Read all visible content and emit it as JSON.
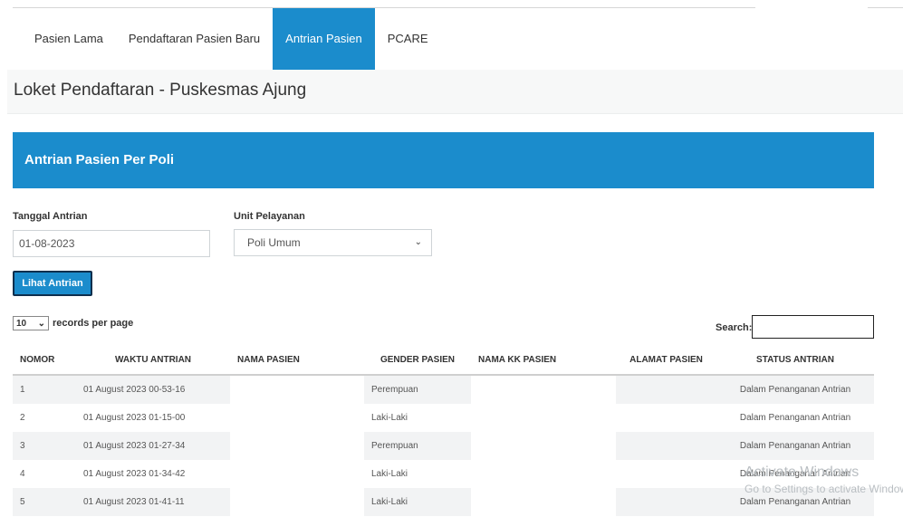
{
  "nav": {
    "items": [
      {
        "label": "Pasien Lama",
        "active": false
      },
      {
        "label": "Pendaftaran Pasien Baru",
        "active": false
      },
      {
        "label": "Antrian Pasien",
        "active": true
      },
      {
        "label": "PCARE",
        "active": false
      }
    ]
  },
  "page": {
    "title": "Loket Pendaftaran - Puskesmas Ajung"
  },
  "panel": {
    "title": "Antrian Pasien Per Poli"
  },
  "form": {
    "date_label": "Tanggal Antrian",
    "date_value": "01-08-2023",
    "unit_label": "Unit Pelayanan",
    "unit_value": "Poli Umum",
    "submit_label": "Lihat Antrian"
  },
  "table_controls": {
    "page_length": "10",
    "records_label": "records per page",
    "search_label": "Search:",
    "search_value": ""
  },
  "table": {
    "headers": [
      "NOMOR",
      "WAKTU ANTRIAN",
      "NAMA PASIEN",
      "GENDER PASIEN",
      "NAMA KK PASIEN",
      "ALAMAT PASIEN",
      "STATUS ANTRIAN"
    ],
    "rows": [
      {
        "nomor": "1",
        "waktu": "01 August 2023 00-53-16",
        "nama": "",
        "gender": "Perempuan",
        "kk": "",
        "alamat": "",
        "status": "Dalam Penanganan Antrian"
      },
      {
        "nomor": "2",
        "waktu": "01 August 2023 01-15-00",
        "nama": "",
        "gender": "Laki-Laki",
        "kk": "",
        "alamat": "",
        "status": "Dalam Penanganan Antrian"
      },
      {
        "nomor": "3",
        "waktu": "01 August 2023 01-27-34",
        "nama": "",
        "gender": "Perempuan",
        "kk": "",
        "alamat": "",
        "status": "Dalam Penanganan Antrian"
      },
      {
        "nomor": "4",
        "waktu": "01 August 2023 01-34-42",
        "nama": "",
        "gender": "Laki-Laki",
        "kk": "",
        "alamat": "",
        "status": "Dalam Penanganan Antrian"
      },
      {
        "nomor": "5",
        "waktu": "01 August 2023 01-41-11",
        "nama": "",
        "gender": "Laki-Laki",
        "kk": "",
        "alamat": "",
        "status": "Dalam Penanganan Antrian"
      }
    ]
  },
  "watermark": {
    "line1": "Activate Windows",
    "line2": "Go to Settings to activate Windows."
  },
  "colors": {
    "accent": "#1b8ccc",
    "button_border": "#0f2f4d"
  }
}
